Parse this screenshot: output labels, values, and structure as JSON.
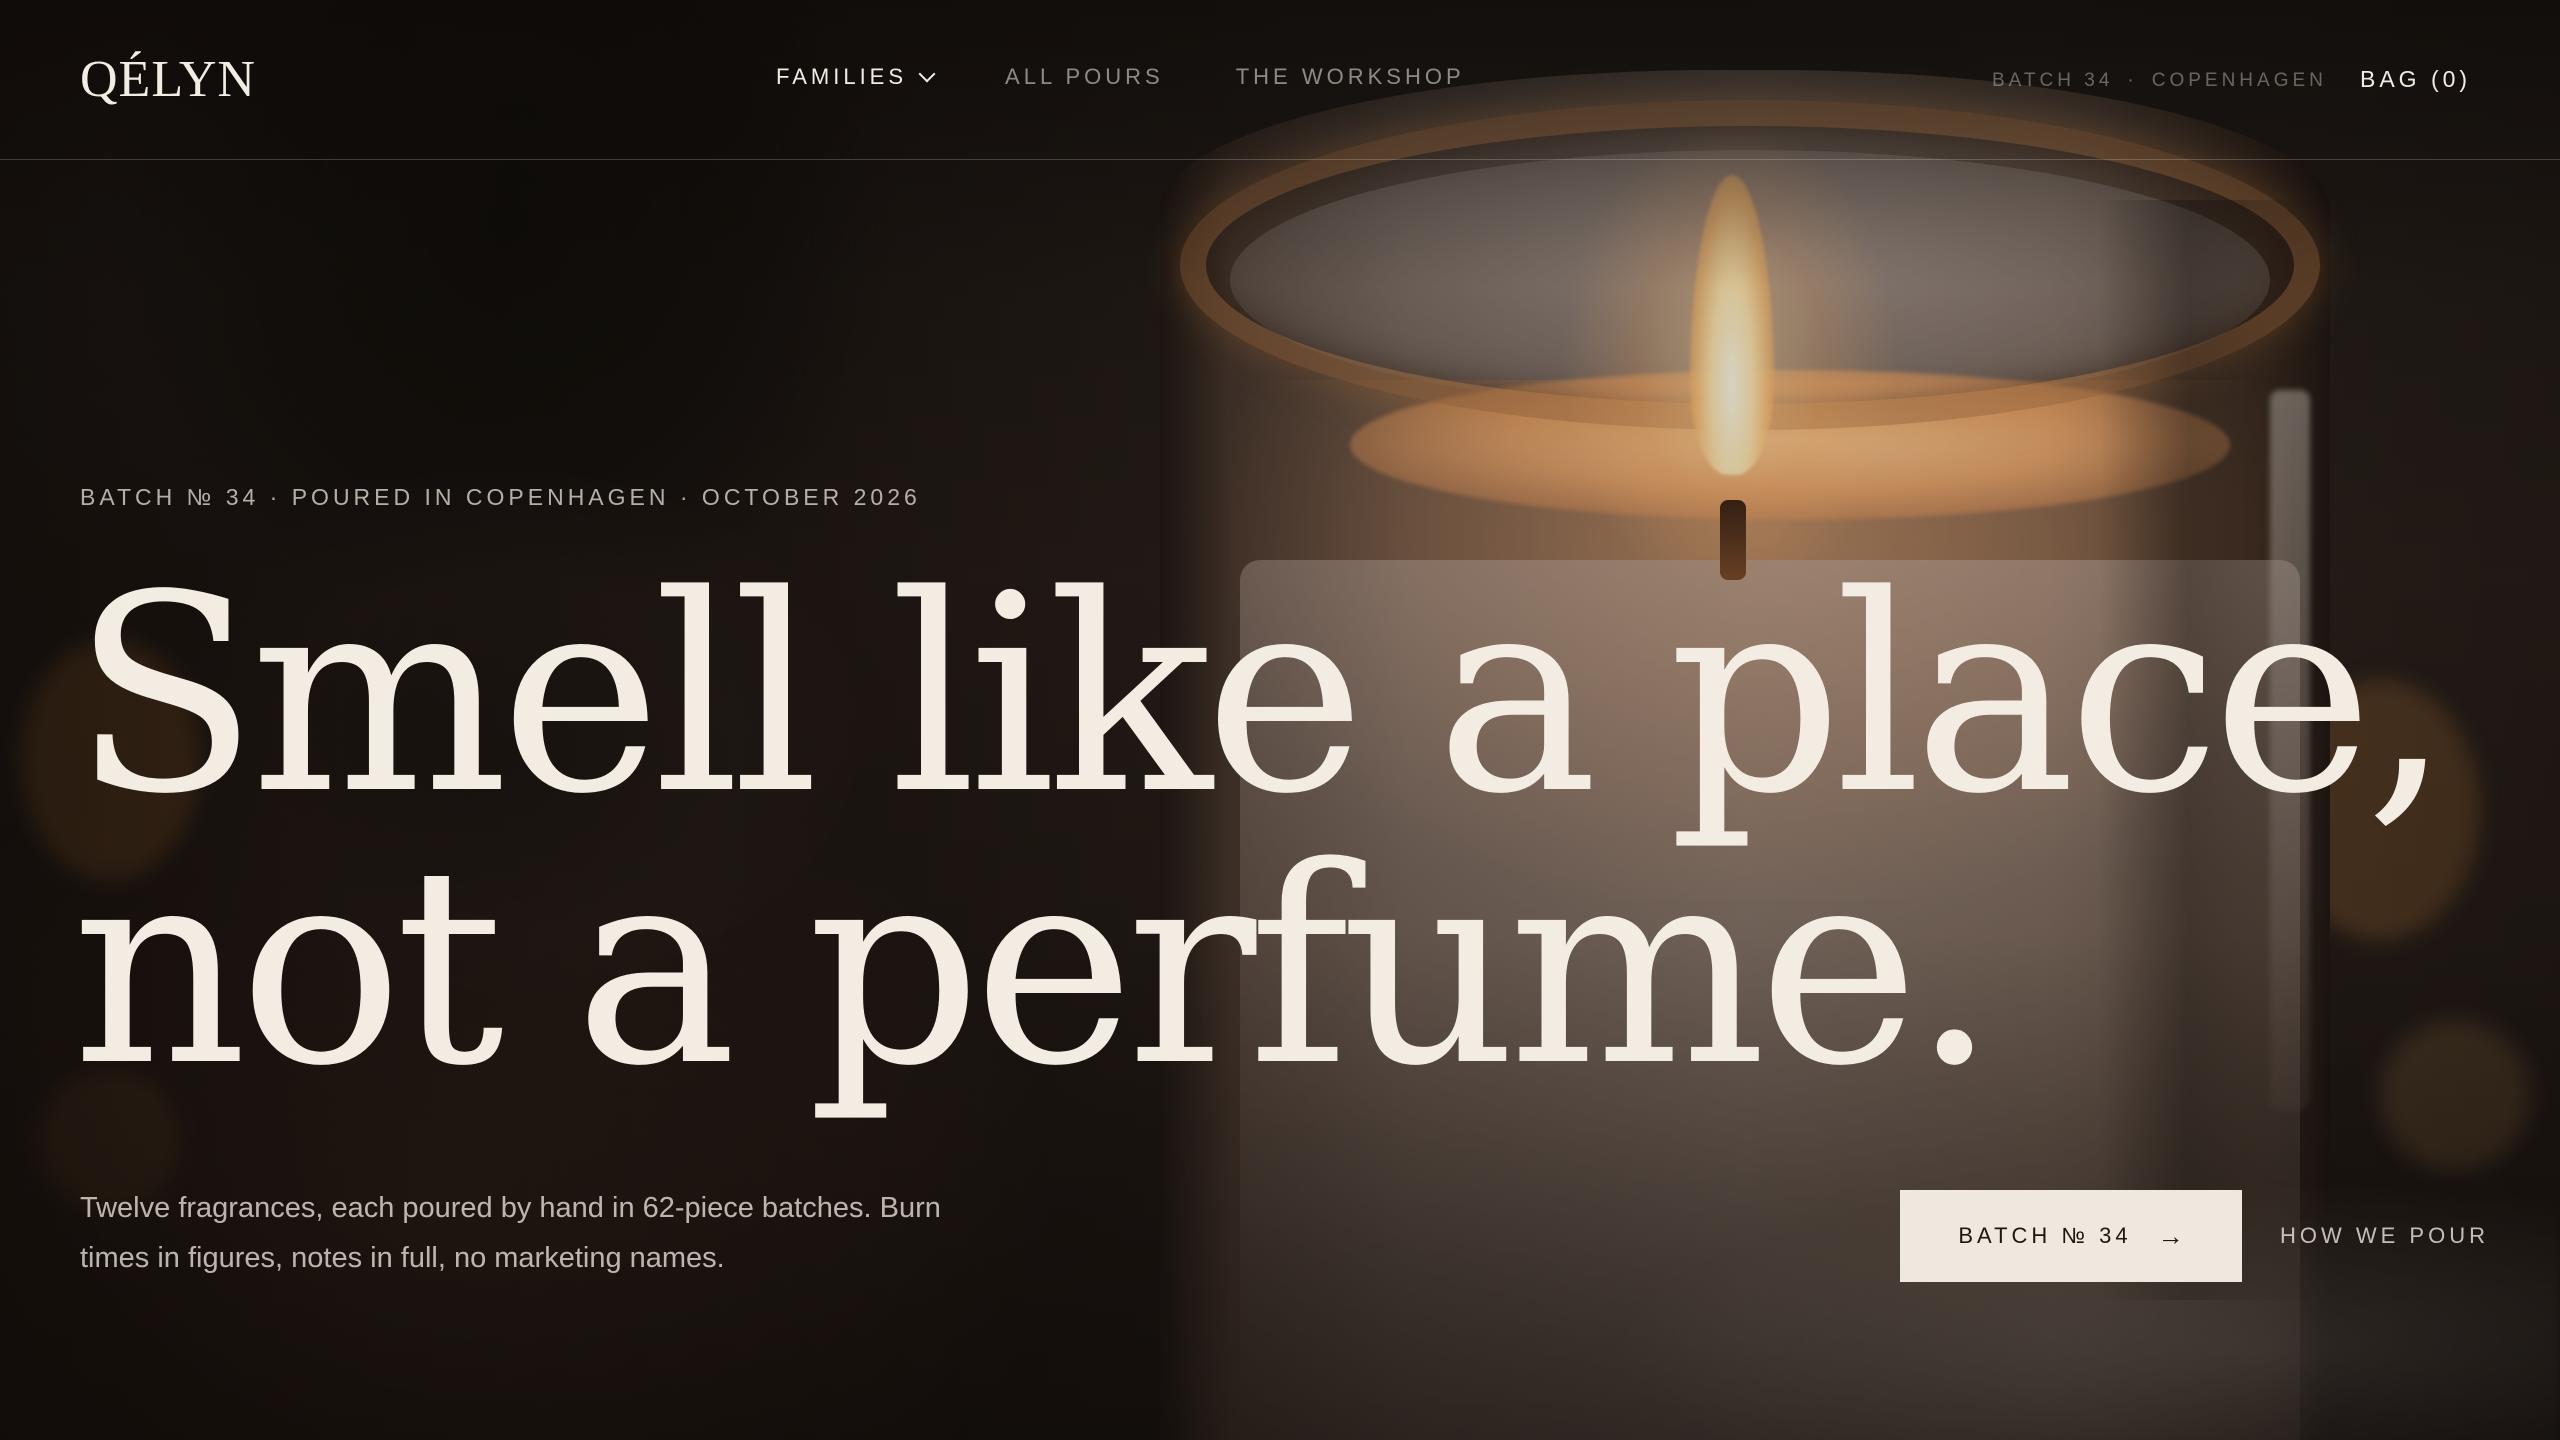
{
  "brand": {
    "logo": "QÉLYN"
  },
  "nav": {
    "items": [
      {
        "label": "FAMILIES",
        "active": true,
        "has_dropdown": true
      },
      {
        "label": "ALL POURS",
        "active": false
      },
      {
        "label": "THE WORKSHOP",
        "active": false
      }
    ],
    "meta_batch": "BATCH 34",
    "meta_separator": "·",
    "meta_location": "COPENHAGEN",
    "bag_label": "BAG",
    "bag_count": "(0)"
  },
  "hero": {
    "eyebrow": "BATCH № 34 · POURED IN COPENHAGEN · OCTOBER 2026",
    "headline_line1": "Smell like a place,",
    "headline_line2": "not a perfume.",
    "subcopy": "Twelve fragrances, each poured by hand in 62-piece batches. Burn times in figures, notes in full, no marketing names.",
    "cta_primary_label": "BATCH № 34",
    "cta_primary_icon": "arrow-right-icon",
    "cta_secondary_label": "HOW WE POUR"
  },
  "colors": {
    "cream": "#f3ece3",
    "button_bg": "#efe8df",
    "dark": "#1d1612"
  }
}
